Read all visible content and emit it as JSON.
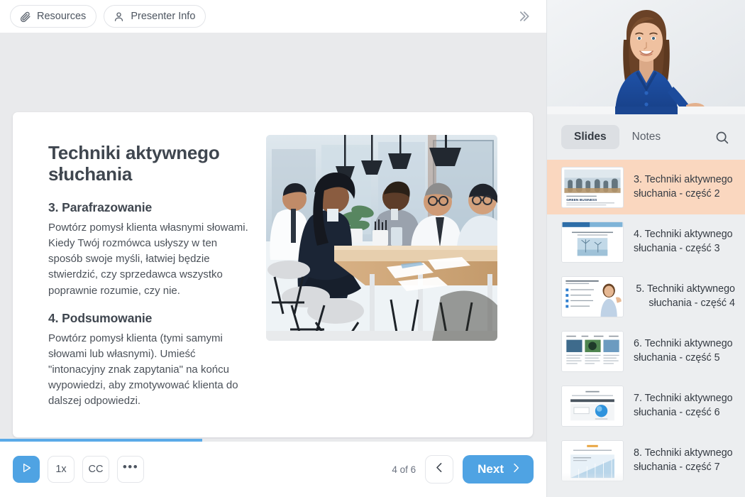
{
  "header": {
    "resources_label": "Resources",
    "presenter_info_label": "Presenter Info",
    "resources_icon": "paperclip-icon",
    "presenter_icon": "person-icon",
    "collapse_icon": "chevron-double-right-icon"
  },
  "slide": {
    "title": "Techniki aktywnego słuchania",
    "sections": [
      {
        "heading": "3. Parafrazowanie",
        "body": "Powtórz pomysł klienta własnymi słowami. Kiedy Twój rozmówca usłyszy w ten sposób swoje myśli, łatwiej będzie stwierdzić, czy sprzedawca wszystko poprawnie rozumie, czy nie."
      },
      {
        "heading": "4. Podsumowanie",
        "body": "Powtórz pomysł klienta (tymi samymi słowami lub własnymi). Umieść \"intonacyjny znak zapytania\" na końcu wypowiedzi, aby zmotywować klienta do dalszej odpowiedzi."
      }
    ],
    "photo_alt": "business-meeting-photo"
  },
  "player": {
    "play_icon": "play-triangle-icon",
    "speed_label": "1x",
    "cc_label": "CC",
    "more_label": "•••",
    "progress_percent": 37,
    "page_counter": "4 of 6",
    "prev_icon": "chevron-left-icon",
    "next_label": "Next",
    "next_icon": "chevron-right-icon"
  },
  "sidebar": {
    "presenter_alt": "presenter-video-woman-blue-top",
    "tabs": [
      {
        "label": "Slides",
        "active": true
      },
      {
        "label": "Notes",
        "active": false
      }
    ],
    "search_icon": "search-icon",
    "slides": [
      {
        "number": "3.",
        "line1": "3. Techniki aktywnego",
        "line2": "słuchania - część 2",
        "active": true,
        "align": "left",
        "thumb": "green-business-meeting"
      },
      {
        "number": "4.",
        "line1": "4. Techniki aktywnego",
        "line2": "słuchania - część 3",
        "active": false,
        "align": "left",
        "thumb": "wind-turbine-report"
      },
      {
        "number": "5.",
        "line1": "5. Techniki aktywnego",
        "line2": "słuchania - część 4",
        "active": false,
        "align": "right",
        "thumb": "woman-bullet-list"
      },
      {
        "number": "6.",
        "line1": "6. Techniki aktywnego",
        "line2": "słuchania - część 5",
        "active": false,
        "align": "left",
        "thumb": "three-column-images"
      },
      {
        "number": "7.",
        "line1": "7. Techniki aktywnego",
        "line2": "słuchania - część 6",
        "active": false,
        "align": "left",
        "thumb": "form-blue-circle"
      },
      {
        "number": "8.",
        "line1": "8. Techniki aktywnego",
        "line2": "słuchania - część 7",
        "active": false,
        "align": "left",
        "thumb": "light-blue-chart"
      }
    ]
  },
  "colors": {
    "accent_blue": "#4fa3e3",
    "active_row_peach": "#fad7bf",
    "panel_gray": "#e9eaec",
    "sidebar_gray": "#eceef0"
  }
}
